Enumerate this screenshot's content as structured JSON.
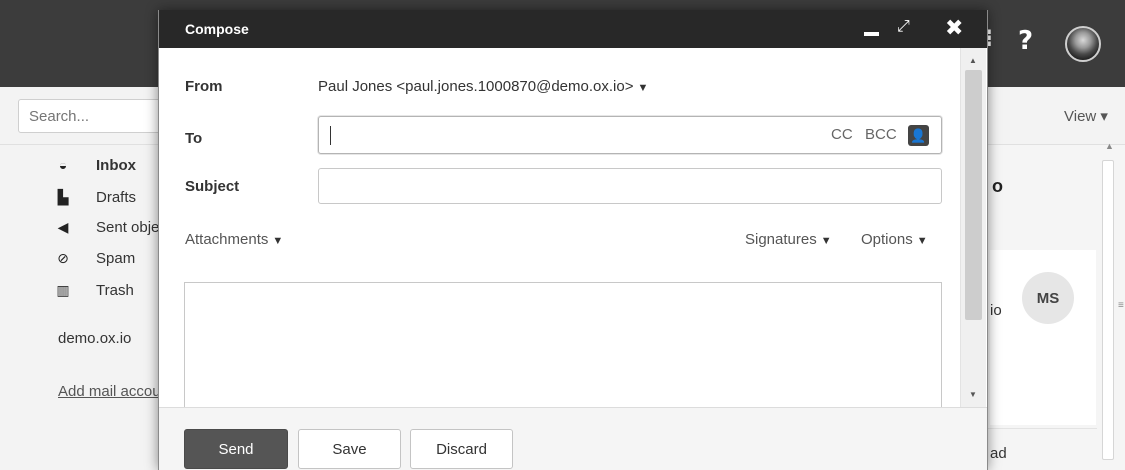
{
  "app": {
    "search_placeholder": "Search...",
    "view_label": "View ▾",
    "help_glyph": "?",
    "partial_glyph": "⁝"
  },
  "sidebar": {
    "items": [
      {
        "label": "Inbox",
        "icon": "inbox-icon",
        "glyph": "◒"
      },
      {
        "label": "Drafts",
        "icon": "file-icon",
        "glyph": "▙"
      },
      {
        "label": "Sent objects",
        "icon": "send-icon",
        "glyph": "◀"
      },
      {
        "label": "Spam",
        "icon": "ban-icon",
        "glyph": "⊘"
      },
      {
        "label": "Trash",
        "icon": "trash-icon",
        "glyph": "▥"
      }
    ],
    "account": "demo.ox.io",
    "add_account": "Add mail account"
  },
  "right_pane": {
    "title_fragment": "o",
    "sender_fragment": "io",
    "avatar_initials": "MS",
    "bottom_fragment": "ad"
  },
  "compose": {
    "title": "Compose",
    "from_label": "From",
    "from_value": "Paul Jones <paul.jones.1000870@demo.ox.io>",
    "to_label": "To",
    "to_value": "",
    "cc_label": "CC",
    "bcc_label": "BCC",
    "subject_label": "Subject",
    "subject_value": "",
    "attachments_label": "Attachments",
    "signatures_label": "Signatures",
    "options_label": "Options",
    "body_value": "",
    "send_label": "Send",
    "save_label": "Save",
    "discard_label": "Discard"
  }
}
